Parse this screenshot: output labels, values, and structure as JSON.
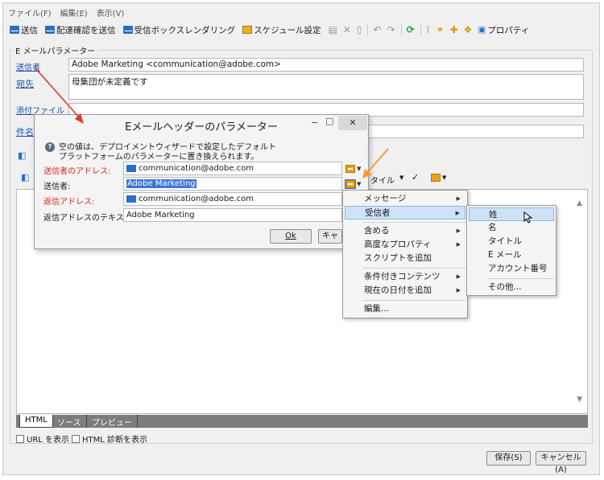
{
  "menubar": [
    "ファイル(F)",
    "編集(E)",
    "表示(V)"
  ],
  "toolbar": {
    "send": "送信",
    "send_proof": "配達確認を送信",
    "inbox_rendering": "受信ボックスレンダリング",
    "schedule": "スケジュール設定",
    "properties": "プロパティ"
  },
  "email_params": {
    "group_title": "E メールパラメーター",
    "sender_label": "送信者",
    "sender_value": "Adobe Marketing <communication@adobe.com>",
    "to_label": "宛先",
    "to_value": "母集団が未定義です",
    "attachments_label": "添付ファイル",
    "subject_label": "件名"
  },
  "editor_toolbar": {
    "style_label": "タイル"
  },
  "bottom_tabs": [
    "HTML",
    "ソース",
    "プレビュー"
  ],
  "options": {
    "show_urls": "URL を表示",
    "html_diag": "HTML 診断を表示"
  },
  "buttons": {
    "save": "保存(S)",
    "cancel": "キャンセル(A)"
  },
  "dialog": {
    "title": "Eメールヘッダーのパラメーター",
    "info_line1": "空の値は、デプロイメントウィザードで設定したデフォルト",
    "info_line2": "プラットフォームのパラメーターに置き換えられます。",
    "sender_addr_label": "送信者のアドレス:",
    "sender_addr_value": "communication@adobe.com",
    "sender_label": "送信者:",
    "sender_value": "Adobe Marketing",
    "reply_addr_label": "返信アドレス:",
    "reply_addr_value": "communication@adobe.com",
    "reply_text_label": "返信アドレスのテキスト:",
    "reply_text_value": "Adobe Marketing",
    "ok": "Ok",
    "cancel": "キャ"
  },
  "context_menu": {
    "items": [
      "メッセージ",
      "受信者",
      "含める",
      "高度なプロパティ",
      "スクリプトを追加",
      "条件付きコンテンツ",
      "現在の日付を追加",
      "編集..."
    ]
  },
  "submenu": {
    "items": [
      "姓",
      "名",
      "タイトル",
      "E メール",
      "アカウント番号",
      "その他..."
    ]
  },
  "colors": {
    "required_label": "#d4281c",
    "highlight": "#cfe3f8",
    "selection": "#3a78d8",
    "annotation_arrow": "#f0a030"
  }
}
